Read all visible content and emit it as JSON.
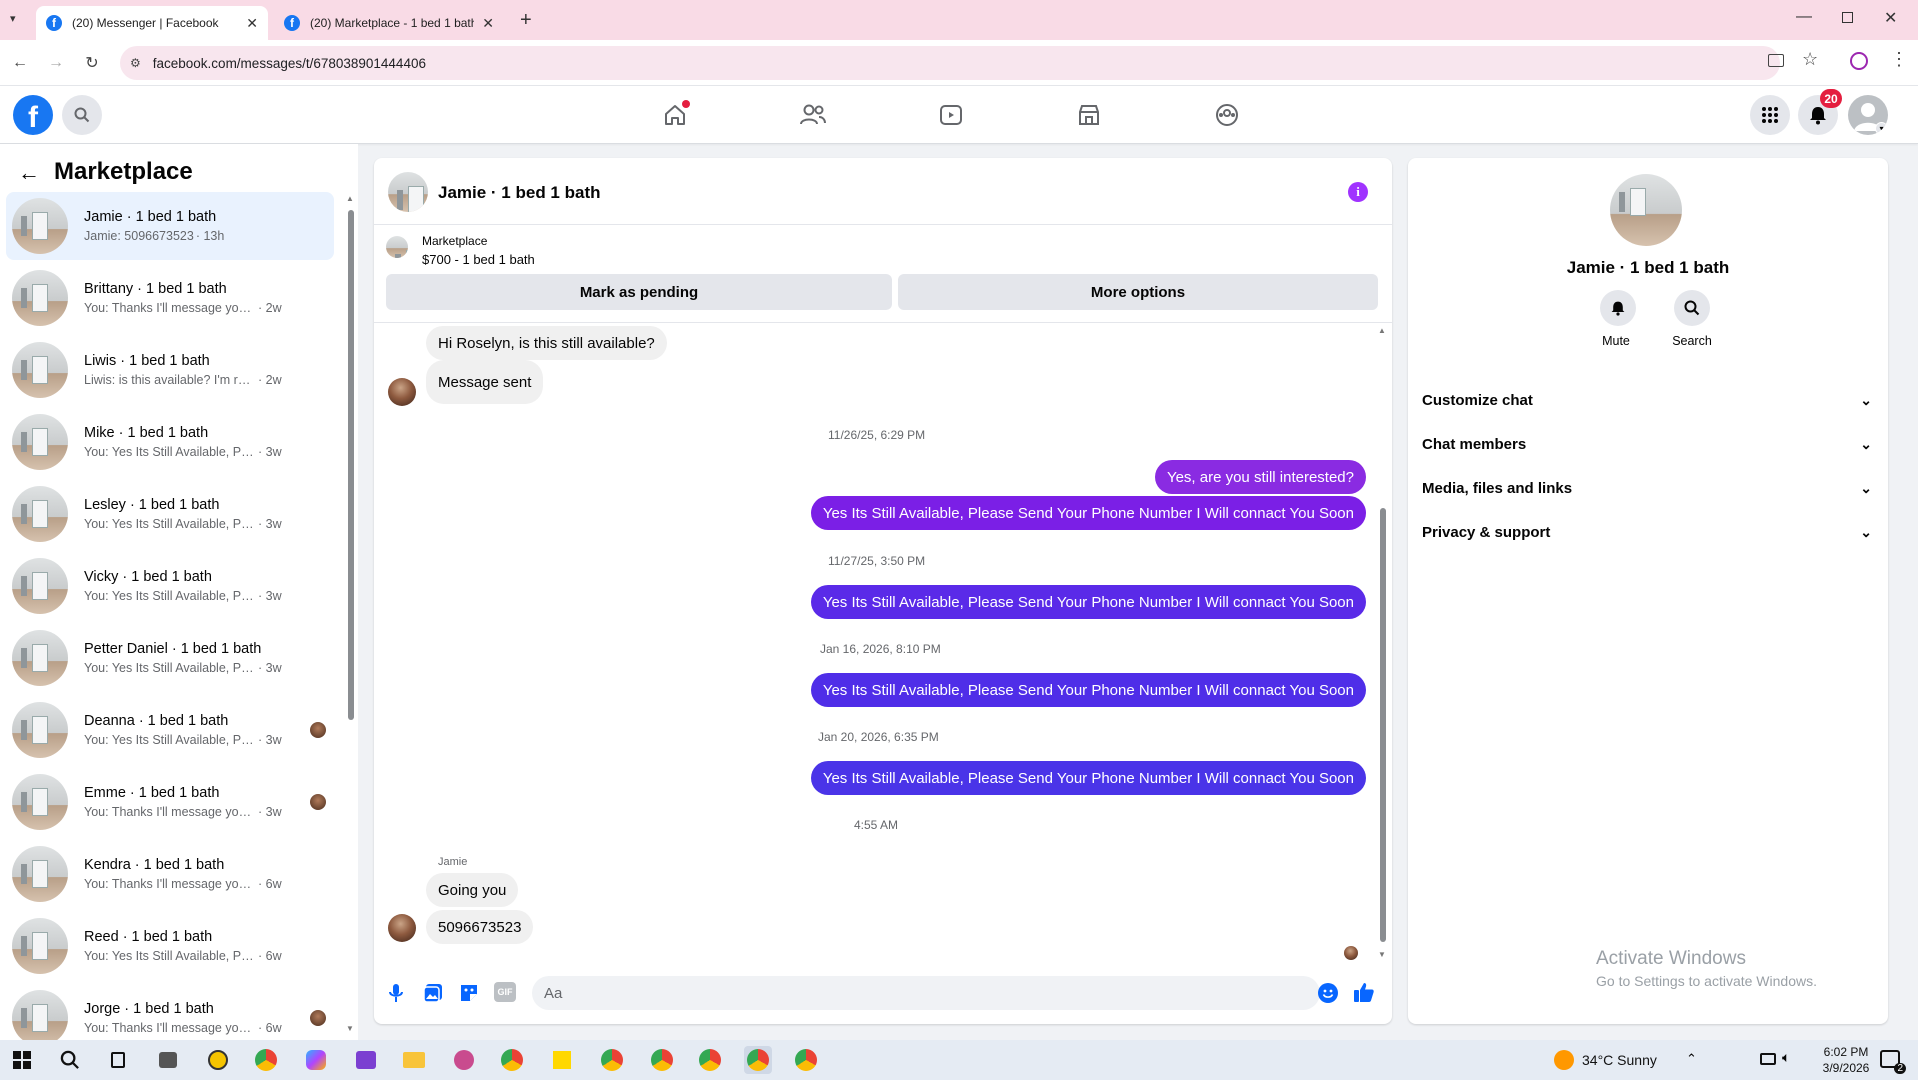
{
  "browser": {
    "tabs": [
      {
        "title": "(20) Messenger | Facebook",
        "active": true
      },
      {
        "title": "(20) Marketplace - 1 bed 1 bath",
        "active": false
      }
    ],
    "url": "facebook.com/messages/t/678038901444406"
  },
  "fb_topbar": {
    "notifications_count": "20"
  },
  "sidebar": {
    "title": "Marketplace",
    "conversations": [
      {
        "name": "Jamie · 1 bed 1 bath",
        "preview": "Jamie: 5096673523",
        "time": " · 13h",
        "selected": true
      },
      {
        "name": "Brittany · 1 bed 1 bath",
        "preview": "You: Thanks I'll message you in a ...",
        "time": " · 2w"
      },
      {
        "name": "Liwis · 1 bed 1 bath",
        "preview": "Liwis: is this available? I'm ready fo...",
        "time": " · 2w"
      },
      {
        "name": "Mike · 1 bed 1 bath",
        "preview": "You: Yes Its Still Available, Please Se...",
        "time": " · 3w"
      },
      {
        "name": "Lesley · 1 bed 1 bath",
        "preview": "You: Yes Its Still Available, Please Se...",
        "time": " · 3w"
      },
      {
        "name": "Vicky · 1 bed 1 bath",
        "preview": "You: Yes Its Still Available, Please Se...",
        "time": " · 3w"
      },
      {
        "name": "Petter Daniel · 1 bed 1 bath",
        "preview": "You: Yes Its Still Available, Please Se...",
        "time": " · 3w"
      },
      {
        "name": "Deanna · 1 bed 1 bath",
        "preview": "You: Yes Its Still Available, Please...",
        "time": " · 3w"
      },
      {
        "name": "Emme · 1 bed 1 bath",
        "preview": "You: Thanks I'll message you in ...",
        "time": " · 3w"
      },
      {
        "name": "Kendra · 1 bed 1 bath",
        "preview": "You: Thanks I'll message you in a ...",
        "time": " · 6w"
      },
      {
        "name": "Reed · 1 bed 1 bath",
        "preview": "You: Yes Its Still Available, Please Se...",
        "time": " · 6w"
      },
      {
        "name": "Jorge · 1 bed 1 bath",
        "preview": "You: Thanks I'll message you in ...",
        "time": " · 6w"
      }
    ]
  },
  "chat": {
    "title": "Jamie · 1 bed 1 bath",
    "listing_source": "Marketplace",
    "listing_title": "$700 - 1 bed 1 bath",
    "mark_pending_label": "Mark as pending",
    "more_options_label": "More options",
    "messages": {
      "m1": "Hi Roselyn, is this still available?",
      "m2": "Message sent",
      "ts1": "11/26/25, 6:29 PM",
      "m3": "Yes, are you still interested?",
      "m4": "Yes Its Still Available, Please Send Your Phone Number I Will connact You Soon",
      "ts2": "11/27/25, 3:50 PM",
      "m5": "Yes Its Still Available, Please Send Your Phone Number I Will connact You Soon",
      "ts3": "Jan 16, 2026, 8:10 PM",
      "m6": "Yes Its Still Available, Please Send Your Phone Number I Will connact You Soon",
      "ts4": "Jan 20, 2026, 6:35 PM",
      "m7": "Yes Its Still Available, Please Send Your Phone Number I Will connact You Soon",
      "ts5": "4:55 AM",
      "sender": "Jamie",
      "m8": "Going you",
      "m9": "5096673523"
    },
    "composer_placeholder": "Aa"
  },
  "details": {
    "name": "Jamie · 1 bed 1 bath",
    "mute_label": "Mute",
    "search_label": "Search",
    "sections": [
      "Customize chat",
      "Chat members",
      "Media, files and links",
      "Privacy & support"
    ]
  },
  "watermark": {
    "line1": "Activate Windows",
    "line2": "Go to Settings to activate Windows."
  },
  "taskbar": {
    "weather": "34°C  Sunny",
    "time": "6:02 PM",
    "date": "3/9/2026",
    "notification_count": "2"
  },
  "colors": {
    "fb_blue": "#1877f2",
    "messenger_purple_1": "#8a2be2",
    "messenger_purple_2": "#7b1fe6",
    "messenger_indigo": "#4f2ee8",
    "notification_red": "#e41e3f",
    "info_icon": "#a033ff"
  }
}
